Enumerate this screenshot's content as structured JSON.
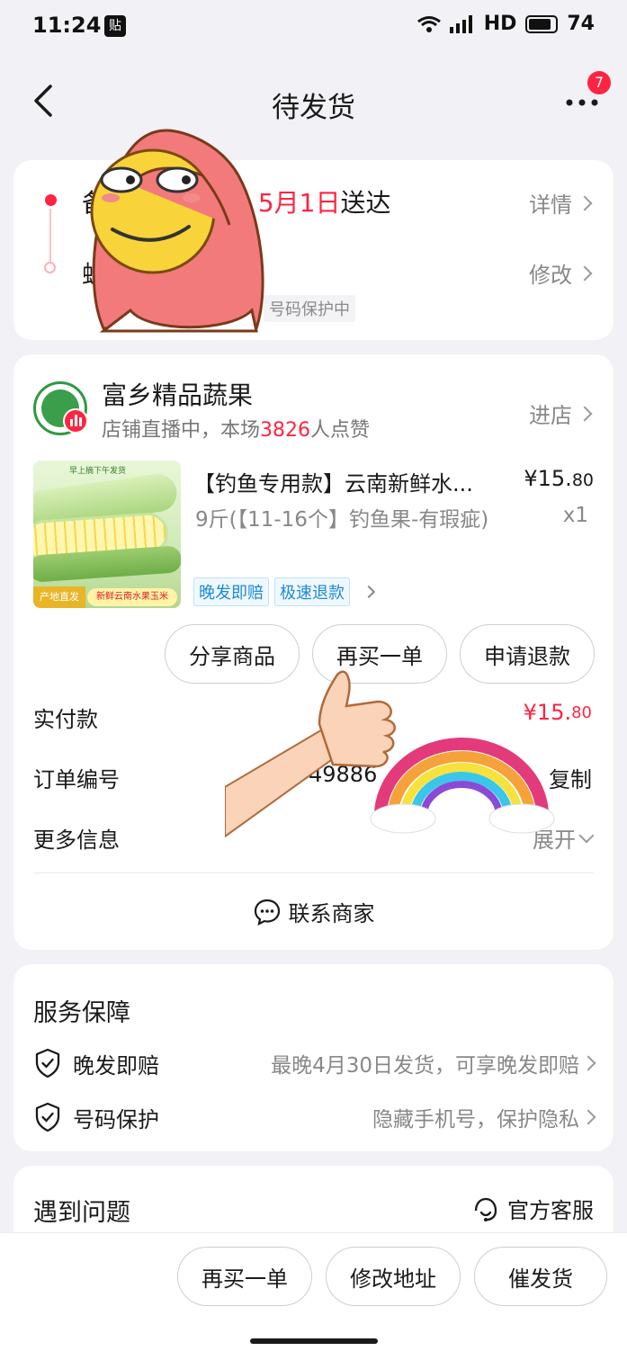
{
  "status_bar": {
    "time": "11:24",
    "notif_icon": "贴",
    "network": "HD",
    "battery": "74"
  },
  "nav": {
    "title": "待发货",
    "badge": "7"
  },
  "delivery": {
    "line1_prefix": "备",
    "line1_date": "5月1日",
    "line1_suffix": "送达",
    "detail_link": "详情",
    "line2_prefix": "蚂",
    "modify_link": "修改",
    "phone_protect_tag": "号码保护中"
  },
  "shop": {
    "name": "富乡精品蔬果",
    "live_prefix": "店铺直播中，本场",
    "live_count": "3826",
    "live_suffix": "人点赞",
    "enter_label": "进店"
  },
  "product": {
    "title": "【钓鱼专用款】云南新鲜水...",
    "price_int": "¥15.",
    "price_dec": "80",
    "spec": "9斤(【11-16个】钓鱼果-有瑕疵)",
    "qty": "x1",
    "tags": [
      "晚发即赔",
      "极速退款"
    ],
    "img_badge_left": "产地直发",
    "img_badge_right": "新鲜云南水果玉米",
    "img_top_text": "早上摘下午发货"
  },
  "actions": {
    "share": "分享商品",
    "rebuy": "再买一单",
    "refund": "申请退款"
  },
  "order_info": {
    "paid_label": "实付款",
    "paid_int": "¥15.",
    "paid_dec": "80",
    "order_no_label": "订单编号",
    "order_no_value": "49886",
    "copy_label": "复制",
    "more_label": "更多信息",
    "expand_label": "展开",
    "contact_label": "联系商家"
  },
  "service": {
    "title": "服务保障",
    "items": [
      {
        "name": "晚发即赔",
        "desc": "最晚4月30日发货，可享晚发即赔"
      },
      {
        "name": "号码保护",
        "desc": "隐藏手机号，保护隐私"
      }
    ]
  },
  "problem": {
    "title": "遇到问题",
    "cs_label": "官方客服"
  },
  "bottom": {
    "rebuy": "再买一单",
    "change_addr": "修改地址",
    "urge": "催发货"
  },
  "colors": {
    "accent": "#ff2442",
    "link_blue": "#1c8ad6",
    "bg": "#f1f1f6"
  }
}
